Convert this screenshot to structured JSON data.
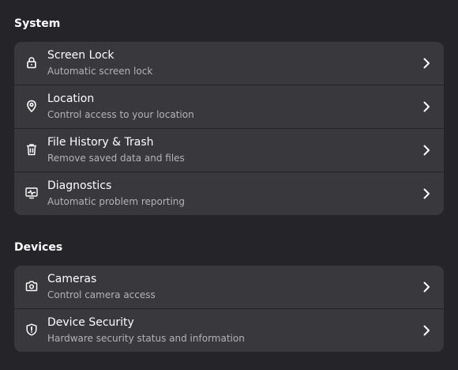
{
  "sections": [
    {
      "title": "System",
      "items": [
        {
          "icon": "lock-icon",
          "title": "Screen Lock",
          "subtitle": "Automatic screen lock"
        },
        {
          "icon": "location-pin-icon",
          "title": "Location",
          "subtitle": "Control access to your location"
        },
        {
          "icon": "trash-icon",
          "title": "File History & Trash",
          "subtitle": "Remove saved data and files"
        },
        {
          "icon": "diagnostics-monitor-icon",
          "title": "Diagnostics",
          "subtitle": "Automatic problem reporting"
        }
      ]
    },
    {
      "title": "Devices",
      "items": [
        {
          "icon": "camera-icon",
          "title": "Cameras",
          "subtitle": "Control camera access"
        },
        {
          "icon": "shield-icon",
          "title": "Device Security",
          "subtitle": "Hardware security status and information"
        }
      ]
    }
  ],
  "colors": {
    "background": "#242429",
    "card": "#38383d",
    "separator": "#222226",
    "text": "#ffffff",
    "subtext": "#b4b4b8"
  }
}
